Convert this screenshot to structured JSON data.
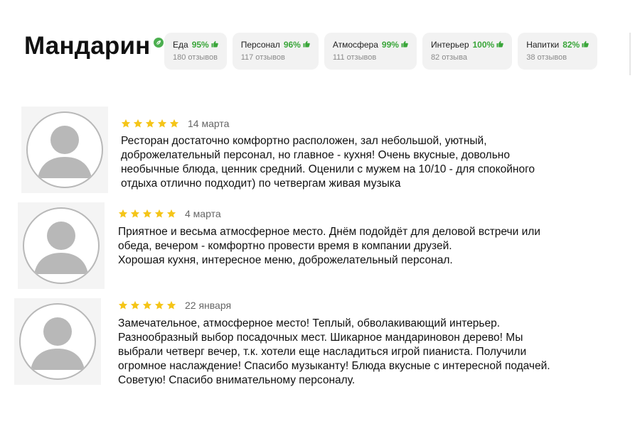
{
  "restaurant": {
    "name": "Мандарин",
    "verified_icon": "verified-leaf-icon",
    "accent_color": "#4caf50"
  },
  "ratings": [
    {
      "label": "Еда",
      "percent": "95%",
      "reviews": "180 отзывов"
    },
    {
      "label": "Персонал",
      "percent": "96%",
      "reviews": "117 отзывов"
    },
    {
      "label": "Атмосфера",
      "percent": "99%",
      "reviews": "111 отзывов"
    },
    {
      "label": "Интерьер",
      "percent": "100%",
      "reviews": "82 отзыва"
    },
    {
      "label": "Напитки",
      "percent": "82%",
      "reviews": "38 отзывов"
    }
  ],
  "reviews": [
    {
      "stars": 5,
      "date": "14 марта",
      "text": "Ресторан достаточно комфортно расположен, зал небольшой, уютный,\nдоброжелательный персонал, но главное - кухня! Очень вкусные, довольно\nнеобычные блюда, ценник средний. Оценили с мужем на 10/10 - для спокойного\nотдыха отлично подходит) по четвергам живая музыка"
    },
    {
      "stars": 5,
      "date": "4 марта",
      "text": "Приятное и весьма атмосферное место. Днём подойдёт для деловой встречи или\nобеда, вечером - комфортно провести время в компании друзей.\nХорошая кухня, интересное меню, доброжелательный персонал."
    },
    {
      "stars": 5,
      "date": "22 января",
      "text": "Замечательное, атмосферное место! Теплый, обволакивающий интерьер.\nРазнообразный выбор посадочных мест. Шикарное мандариновон дерево! Мы\nвыбрали четверг вечер, т.к. хотели еще насладиться игрой пианиста. Получили\nогромное наслаждение! Спасибо музыканту! Блюда вкусные с интересной подачей.\nСоветую! Спасибо внимательному персоналу."
    }
  ],
  "colors": {
    "star": "#f5c518",
    "percent_green": "#3aa63a",
    "chip_bg": "#f2f2f2"
  }
}
